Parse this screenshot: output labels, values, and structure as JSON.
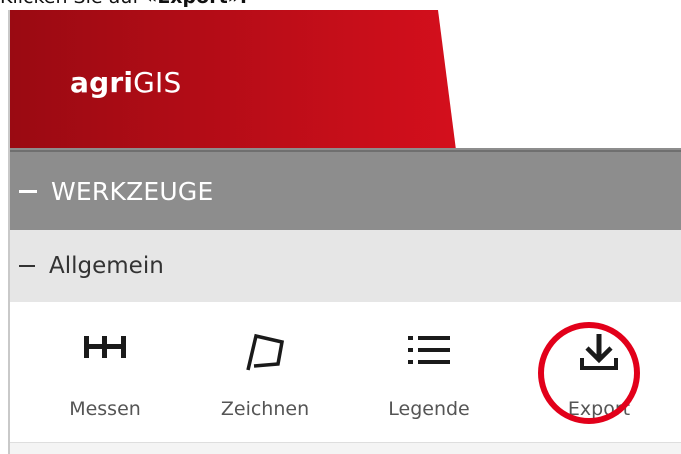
{
  "instruction": {
    "prefix": "Klicken Sie auf ",
    "target": "«Export».",
    "full": "Klicken Sie auf «Export»."
  },
  "app": {
    "logo_bold": "agri",
    "logo_regular": "GIS",
    "brand_color": "#c8101e"
  },
  "sections": {
    "werkzeuge": {
      "label": "WERKZEUGE",
      "icon": "minus-icon"
    },
    "allgemein": {
      "label": "Allgemein",
      "icon": "minus-icon"
    }
  },
  "tools": [
    {
      "label": "Messen",
      "icon": "measure-icon"
    },
    {
      "label": "Zeichnen",
      "icon": "draw-polygon-icon"
    },
    {
      "label": "Legende",
      "icon": "list-icon"
    },
    {
      "label": "Export",
      "icon": "download-icon",
      "highlighted": true
    }
  ],
  "highlight_color": "#e2001a"
}
